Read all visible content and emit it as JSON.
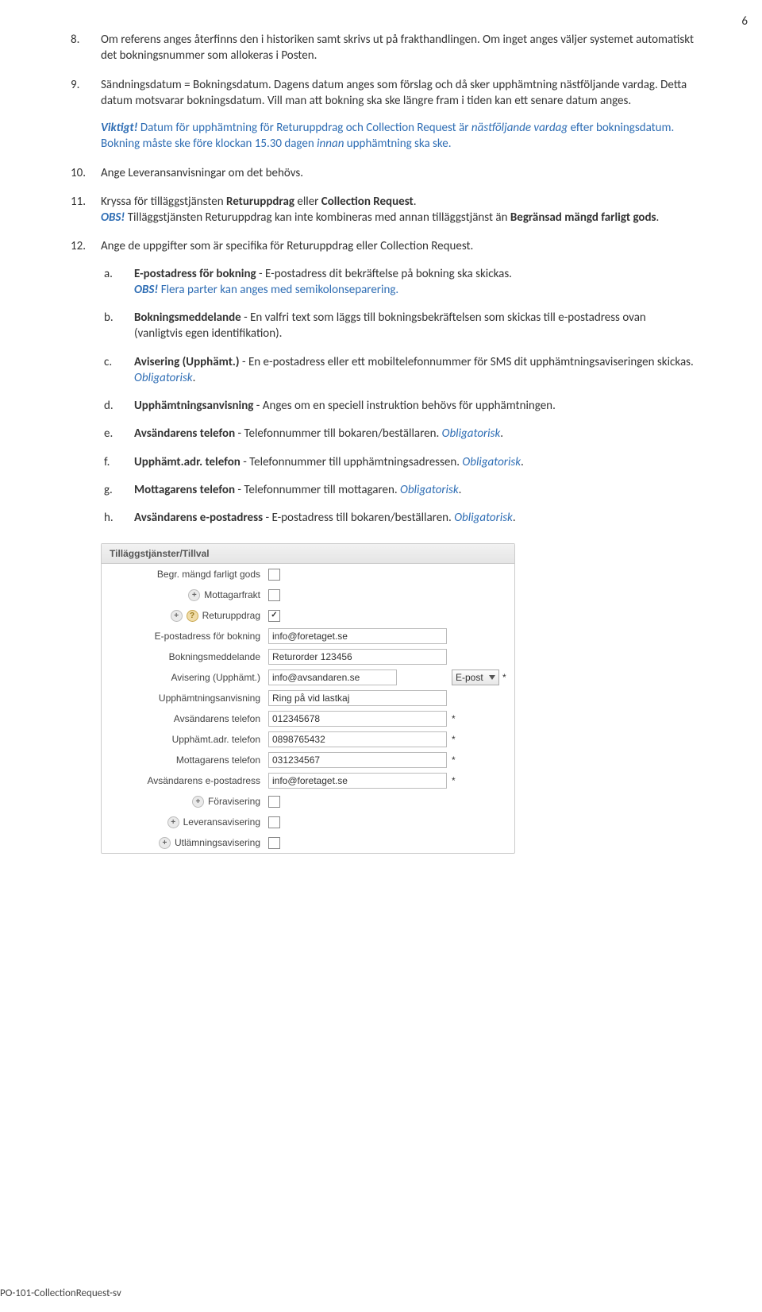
{
  "page_number": "6",
  "footer": "PO-101-CollectionRequest-sv",
  "items": {
    "i8": {
      "num": "8.",
      "text": "Om referens anges återfinns den i historiken samt skrivs ut på frakthandlingen. Om inget anges väljer systemet automatiskt det bokningsnummer som allokeras i Posten."
    },
    "i9": {
      "num": "9.",
      "p1": "Sändningsdatum = Bokningsdatum. Dagens datum anges som förslag och då sker upphämtning nästföljande vardag. Detta datum motsvarar bokningsdatum. Vill man att bokning ska ske längre fram i tiden kan ett senare datum anges.",
      "viktigt_label": "Viktigt!",
      "p2a": " Datum för upphämtning för ",
      "p2b": "Returuppdrag",
      "p2c": " och ",
      "p2d": "Collection Request",
      "p2e": " är ",
      "p2f": "nästföljande vardag",
      "p2g": " efter bokningsdatum. Bokning måste ske före klockan 15.30 dagen ",
      "p2h": "innan",
      "p2i": " upphämtning ska ske."
    },
    "i10": {
      "num": "10.",
      "text": "Ange Leveransanvisningar om det behövs."
    },
    "i11": {
      "num": "11.",
      "line1a": "Kryssa för tilläggstjänsten ",
      "line1b": "Returuppdrag",
      "line1c": " eller ",
      "line1d": "Collection Request",
      "line1e": ".",
      "obs": "OBS!",
      "line2a": " Tilläggstjänsten Returuppdrag kan inte kombineras med annan tilläggstjänst än ",
      "line2b": "Begränsad mängd farligt gods",
      "line2c": "."
    },
    "i12": {
      "num": "12.",
      "text": "Ange de uppgifter som är specifika för Returuppdrag eller Collection Request.",
      "sub": {
        "a": {
          "l": "a.",
          "b": "E-postadress för bokning",
          "t": " - E-postadress dit bekräftelse på bokning ska skickas.",
          "obs": "OBS!",
          "t2": " Flera parter kan anges med semikolonseparering."
        },
        "b": {
          "l": "b.",
          "b": "Bokningsmeddelande",
          "t": " - En valfri text som läggs till bokningsbekräftelsen som skickas till e-postadress ovan (vanligtvis egen identifikation)."
        },
        "c": {
          "l": "c.",
          "b": "Avisering (Upphämt.)",
          "t": " - En e-postadress eller ett mobiltelefonnummer för SMS dit upphämtningsaviseringen skickas. ",
          "ob": "Obligatorisk",
          "dot": "."
        },
        "d": {
          "l": "d.",
          "b": "Upphämtningsanvisning",
          "t": " - Anges om en speciell instruktion behövs för upphämtningen."
        },
        "e": {
          "l": "e.",
          "b": "Avsändarens telefon",
          "t": " - Telefonnummer till bokaren/beställaren. ",
          "ob": "Obligatorisk",
          "dot": "."
        },
        "f": {
          "l": "f.",
          "b": "Upphämt.adr. telefon",
          "t": " - Telefonnummer till upphämtningsadressen. ",
          "ob": "Obligatorisk",
          "dot": "."
        },
        "g": {
          "l": "g.",
          "b": "Mottagarens telefon",
          "t": " - Telefonnummer till mottagaren. ",
          "ob": "Obligatorisk",
          "dot": "."
        },
        "h": {
          "l": "h.",
          "b": "Avsändarens e-postadress",
          "t": " - E-postadress till bokaren/beställaren. ",
          "ob": "Obligatorisk",
          "dot": "."
        }
      }
    }
  },
  "form": {
    "header": "Tilläggstjänster/Tillval",
    "rows": {
      "r1": {
        "label": "Begr. mängd farligt gods"
      },
      "r2": {
        "label": "Mottagarfrakt"
      },
      "r3": {
        "label": "Returuppdrag"
      },
      "r4": {
        "label": "E-postadress för bokning",
        "value": "info@foretaget.se"
      },
      "r5": {
        "label": "Bokningsmeddelande",
        "value": "Returorder 123456"
      },
      "r6": {
        "label": "Avisering (Upphämt.)",
        "value": "info@avsandaren.se",
        "select": "E-post",
        "ast": "*"
      },
      "r7": {
        "label": "Upphämtningsanvisning",
        "value": "Ring på vid lastkaj"
      },
      "r8": {
        "label": "Avsändarens telefon",
        "value": "012345678",
        "ast": "*"
      },
      "r9": {
        "label": "Upphämt.adr. telefon",
        "value": "0898765432",
        "ast": "*"
      },
      "r10": {
        "label": "Mottagarens telefon",
        "value": "031234567",
        "ast": "*"
      },
      "r11": {
        "label": "Avsändarens e-postadress",
        "value": "info@foretaget.se",
        "ast": "*"
      },
      "r12": {
        "label": "Föravisering"
      },
      "r13": {
        "label": "Leveransavisering"
      },
      "r14": {
        "label": "Utlämningsavisering"
      }
    }
  }
}
